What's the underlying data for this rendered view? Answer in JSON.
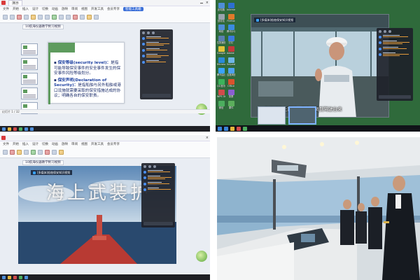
{
  "q1": {
    "title_tab": "演示",
    "doc_tab": "10航海仪器教学附习视频",
    "menus": [
      "文件",
      "开始",
      "插入",
      "设计",
      "切换",
      "动画",
      "放映",
      "审阅",
      "视图",
      "开发工具",
      "会员专享",
      "智能工具箱"
    ],
    "active_menu": "智能工具箱",
    "thumb_numbers": [
      "1",
      "2",
      "3",
      "4",
      "5",
      "6"
    ],
    "bullets": [
      {
        "lead": "保安等级(security level)：",
        "body": "是指可能导致保安事件的安全事件发生的保安事件风险等级划分。"
      },
      {
        "lead": "保安声明(Declaration of Security)：",
        "body": "是指船舶与另外船舶或港口设施就需要采取的保安措施达成的协议；明确各自的保安职责。"
      }
    ],
    "status": "幻灯片 1 / 32"
  },
  "q2": {
    "meeting_title": "[多媒体]船舶保安知识视频",
    "subtitle": "在天线桅上同时一同去人员到驾驶台来",
    "desktop_icons": [
      "此电脑",
      "回收站",
      "网络",
      "控制面板",
      "Google Chrome",
      "Microsoft Edge",
      "腾讯会议",
      "QQ音乐",
      "WPS Office",
      "微信",
      "Internet Explorer",
      "Firefox",
      "腾讯QQ",
      "钉钉",
      "Adobe Reader",
      "Snipaste",
      "百度网盘",
      "Office",
      "录屏",
      "课件"
    ]
  },
  "q3": {
    "doc_tab": "10航海仪器教学附习视频",
    "menus": [
      "文件",
      "开始",
      "插入",
      "设计",
      "切换",
      "动画",
      "放映",
      "审阅",
      "视图",
      "开发工具",
      "会员专享"
    ],
    "banner_text": "海上武装护",
    "meeting_title": "[多媒体]船舶保安知识视频"
  },
  "q4": {
    "scene": "船舶驾驶台模拟器"
  },
  "colors": {
    "wps_accent": "#3b6fd8",
    "chat_bg": "#1e222a",
    "taskbar": "#1e1f24",
    "slide_green": "#5e9b5e"
  }
}
